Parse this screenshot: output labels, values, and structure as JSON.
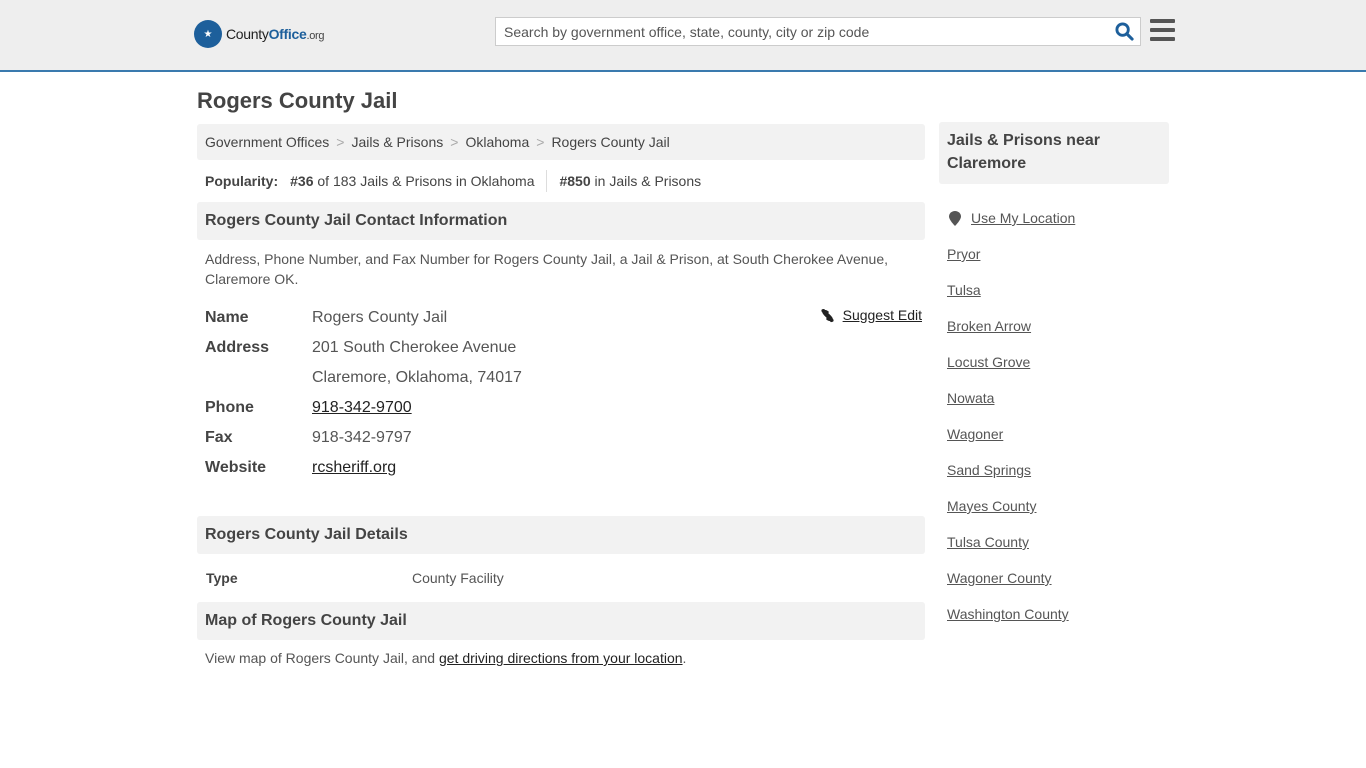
{
  "header": {
    "logo_main": "County",
    "logo_accent": "Office",
    "logo_tld": ".org",
    "search_placeholder": "Search by government office, state, county, city or zip code",
    "search_value": ""
  },
  "page_title": "Rogers County Jail",
  "breadcrumb": [
    {
      "label": "Government Offices"
    },
    {
      "label": "Jails & Prisons"
    },
    {
      "label": "Oklahoma"
    },
    {
      "label": "Rogers County Jail"
    }
  ],
  "breadcrumb_separator": ">",
  "popularity": {
    "label": "Popularity:",
    "state_rank": "#36",
    "state_text": "of 183 Jails & Prisons in Oklahoma",
    "national_rank": "#850",
    "national_text": "in Jails & Prisons"
  },
  "contact": {
    "heading": "Rogers County Jail Contact Information",
    "description": "Address, Phone Number, and Fax Number for Rogers County Jail, a Jail & Prison, at South Cherokee Avenue, Claremore OK.",
    "suggest_edit": "Suggest Edit",
    "fields": {
      "name_label": "Name",
      "name": "Rogers County Jail",
      "address_label": "Address",
      "address_line1": "201 South Cherokee Avenue",
      "address_line2": "Claremore, Oklahoma, 74017",
      "phone_label": "Phone",
      "phone": "918-342-9700",
      "fax_label": "Fax",
      "fax": "918-342-9797",
      "website_label": "Website",
      "website": "rcsheriff.org"
    }
  },
  "details": {
    "heading": "Rogers County Jail Details",
    "type_label": "Type",
    "type_value": "County Facility"
  },
  "map": {
    "heading": "Map of Rogers County Jail",
    "text_before": "View map of Rogers County Jail, and ",
    "link": "get driving directions from your location",
    "text_after": "."
  },
  "sidebar": {
    "heading": "Jails & Prisons near Claremore",
    "use_location": "Use My Location",
    "items": [
      {
        "label": "Pryor"
      },
      {
        "label": "Tulsa"
      },
      {
        "label": "Broken Arrow"
      },
      {
        "label": "Locust Grove"
      },
      {
        "label": "Nowata"
      },
      {
        "label": "Wagoner"
      },
      {
        "label": "Sand Springs"
      },
      {
        "label": "Mayes County"
      },
      {
        "label": "Tulsa County"
      },
      {
        "label": "Wagoner County"
      },
      {
        "label": "Washington County"
      }
    ]
  }
}
